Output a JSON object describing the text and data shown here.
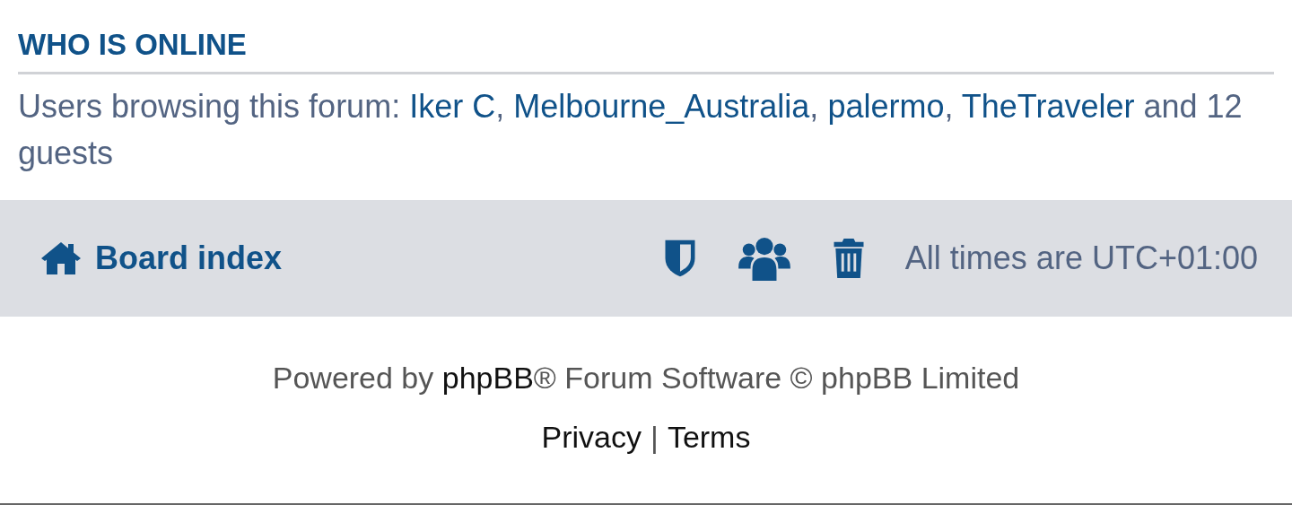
{
  "online": {
    "heading": "WHO IS ONLINE",
    "segments": [
      {
        "kind": "text",
        "text": "Users browsing this forum: "
      },
      {
        "kind": "link",
        "text": "Iker C"
      },
      {
        "kind": "text",
        "text": ", "
      },
      {
        "kind": "link",
        "text": "Melbourne_Australia"
      },
      {
        "kind": "text",
        "text": ", "
      },
      {
        "kind": "link",
        "text": "palermo"
      },
      {
        "kind": "text",
        "text": ", "
      },
      {
        "kind": "link",
        "text": "TheTraveler"
      },
      {
        "kind": "text",
        "text": " and 12 guests"
      }
    ]
  },
  "navbar": {
    "home": "Board index",
    "icons": [
      {
        "kind": "shield"
      },
      {
        "kind": "users"
      },
      {
        "kind": "trash"
      }
    ],
    "timezone": "All times are UTC+01:00"
  },
  "footer": {
    "credit": [
      {
        "kind": "text",
        "text": "Powered by "
      },
      {
        "kind": "link",
        "text": "phpBB"
      },
      {
        "kind": "text",
        "text": "® Forum Software © phpBB Limited"
      }
    ],
    "links": [
      {
        "kind": "link",
        "text": "Privacy"
      },
      {
        "kind": "sep",
        "text": "|"
      },
      {
        "kind": "link",
        "text": "Terms"
      }
    ]
  }
}
